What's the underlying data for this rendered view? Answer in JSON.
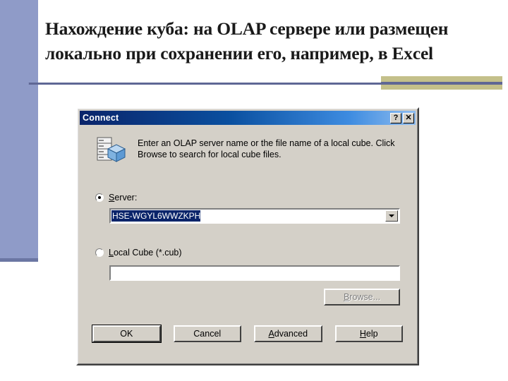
{
  "slide": {
    "title": "Нахождение куба: на OLAP сервере или размещен локально при сохранении его, например, в Excel",
    "accent_color": "#8f9bc8",
    "divider_color": "#5f6795",
    "gold_accent_color": "#c4c08a"
  },
  "dialog": {
    "title": "Connect",
    "titlebar_color_start": "#0a246a",
    "titlebar_color_end": "#8fbdf0",
    "help_button": "?",
    "close_button": "✕",
    "icon_name": "olap-cube-server-icon",
    "description": "Enter an OLAP server name or the file name of a local cube. Click Browse to search for local cube files.",
    "server_option": {
      "label": "Server:",
      "label_accesskey": "S",
      "selected": true,
      "value": "HSE-WGYL6WWZKPH",
      "value_selected": true,
      "placeholder": ""
    },
    "local_cube_option": {
      "label": "Local Cube (*.cub)",
      "label_accesskey": "L",
      "selected": false,
      "value": "",
      "placeholder": ""
    },
    "browse_button": {
      "label": "Browse...",
      "accesskey": "B",
      "disabled": true
    },
    "buttons": [
      {
        "label": "OK",
        "default": true
      },
      {
        "label": "Cancel",
        "default": false
      },
      {
        "label": "Advanced",
        "accesskey": "A",
        "default": false
      },
      {
        "label": "Help",
        "accesskey": "H",
        "default": false
      }
    ]
  }
}
